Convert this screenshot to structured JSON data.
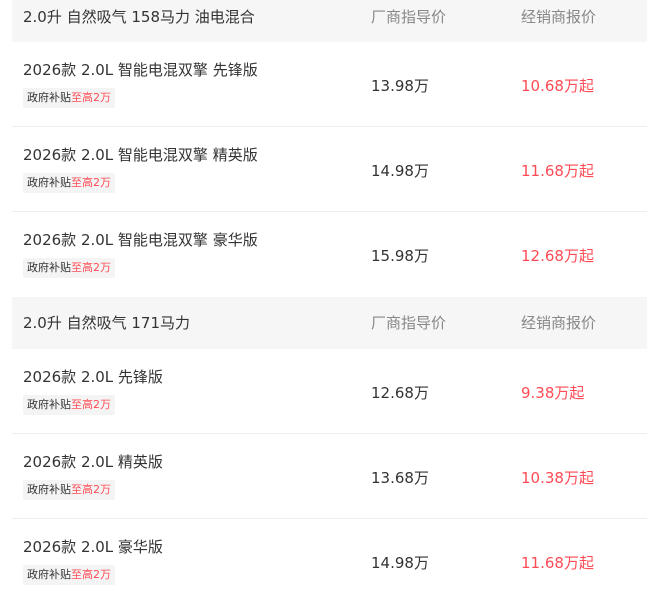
{
  "groups": [
    {
      "title": "2.0升 自然吸气 158马力 油电混合",
      "col_msrp": "厂商指导价",
      "col_dealer": "经销商报价",
      "rows": [
        {
          "model": "2026款 2.0L 智能电混双擎 先锋版",
          "subsidy_label": "政府补贴",
          "subsidy_amount": "至高2万",
          "msrp": "13.98万",
          "dealer": "10.68万起"
        },
        {
          "model": "2026款 2.0L 智能电混双擎 精英版",
          "subsidy_label": "政府补贴",
          "subsidy_amount": "至高2万",
          "msrp": "14.98万",
          "dealer": "11.68万起"
        },
        {
          "model": "2026款 2.0L 智能电混双擎 豪华版",
          "subsidy_label": "政府补贴",
          "subsidy_amount": "至高2万",
          "msrp": "15.98万",
          "dealer": "12.68万起"
        }
      ]
    },
    {
      "title": "2.0升 自然吸气 171马力",
      "col_msrp": "厂商指导价",
      "col_dealer": "经销商报价",
      "rows": [
        {
          "model": "2026款 2.0L 先锋版",
          "subsidy_label": "政府补贴",
          "subsidy_amount": "至高2万",
          "msrp": "12.68万",
          "dealer": "9.38万起"
        },
        {
          "model": "2026款 2.0L 精英版",
          "subsidy_label": "政府补贴",
          "subsidy_amount": "至高2万",
          "msrp": "13.68万",
          "dealer": "10.38万起"
        },
        {
          "model": "2026款 2.0L 豪华版",
          "subsidy_label": "政府补贴",
          "subsidy_amount": "至高2万",
          "msrp": "14.98万",
          "dealer": "11.68万起"
        }
      ]
    }
  ]
}
